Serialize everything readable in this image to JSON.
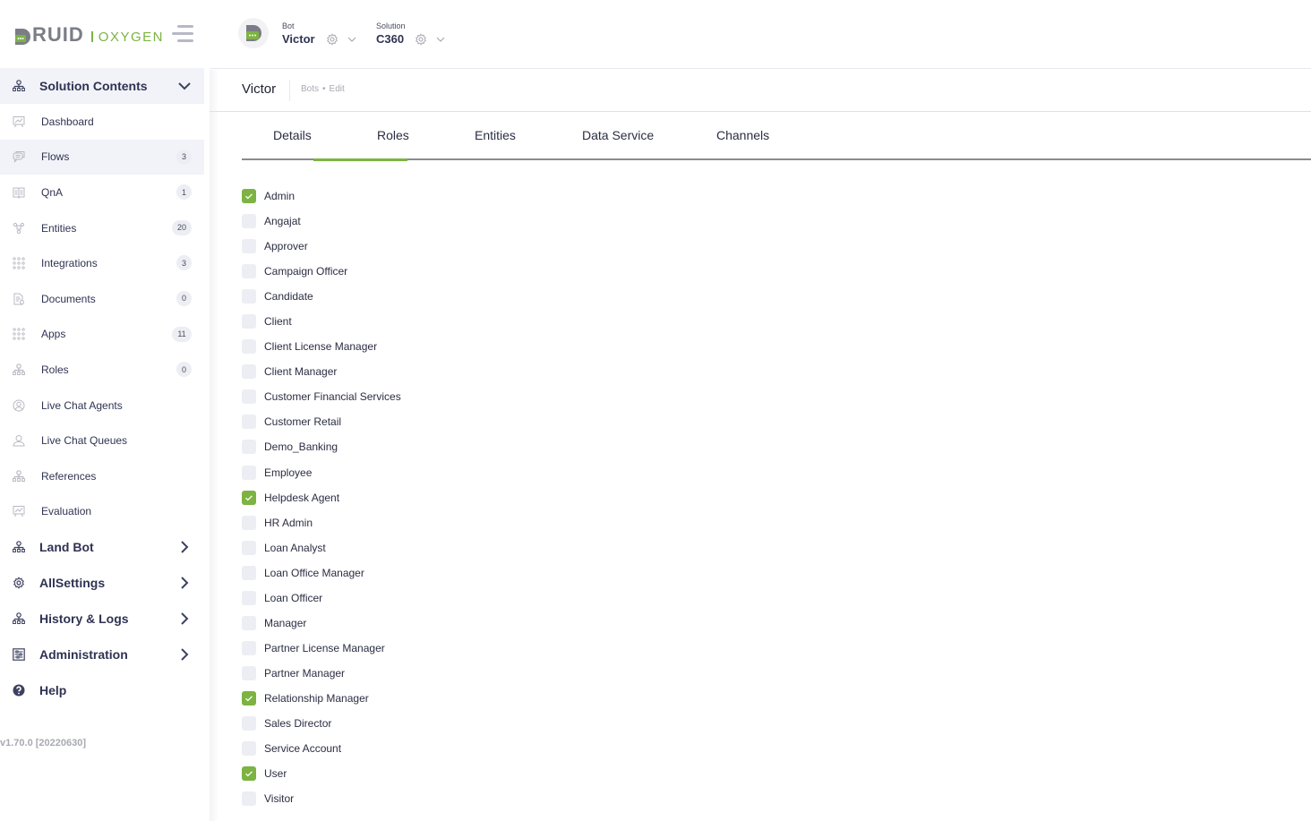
{
  "brand": {
    "name": "DRUID",
    "product": "OXYGEN",
    "accent_color": "#7cb342"
  },
  "header": {
    "bot": {
      "caption": "Bot",
      "value": "Victor"
    },
    "solution": {
      "caption": "Solution",
      "value": "C360"
    }
  },
  "sidebar": {
    "section": {
      "label": "Solution Contents",
      "icon": "sitemap-icon",
      "expanded": true
    },
    "items": [
      {
        "label": "Dashboard",
        "icon": "presentation-chart-icon",
        "badge": null,
        "active": false
      },
      {
        "label": "Flows",
        "icon": "chat-bubbles-icon",
        "badge": "3",
        "active": true
      },
      {
        "label": "QnA",
        "icon": "book-icon",
        "badge": "1",
        "active": false
      },
      {
        "label": "Entities",
        "icon": "entities-icon",
        "badge": "20",
        "active": false
      },
      {
        "label": "Integrations",
        "icon": "grid-dots-icon",
        "badge": "3",
        "active": false
      },
      {
        "label": "Documents",
        "icon": "document-icon",
        "badge": "0",
        "active": false
      },
      {
        "label": "Apps",
        "icon": "grid-dots-icon",
        "badge": "11",
        "active": false
      },
      {
        "label": "Roles",
        "icon": "sitemap-icon",
        "badge": "0",
        "active": false
      },
      {
        "label": "Live Chat Agents",
        "icon": "user-circle-icon",
        "badge": null,
        "active": false
      },
      {
        "label": "Live Chat Queues",
        "icon": "users-queue-icon",
        "badge": null,
        "active": false
      },
      {
        "label": "References",
        "icon": "sitemap-icon",
        "badge": null,
        "active": false
      },
      {
        "label": "Evaluation",
        "icon": "presentation-chart-icon",
        "badge": null,
        "active": false
      }
    ],
    "sections": [
      {
        "label": "Land Bot",
        "icon": "sitemap-icon"
      },
      {
        "label": "AllSettings",
        "icon": "gear-icon"
      },
      {
        "label": "History & Logs",
        "icon": "sitemap-icon"
      },
      {
        "label": "Administration",
        "icon": "sliders-icon"
      },
      {
        "label": "Help",
        "icon": "help-circle-icon"
      }
    ],
    "version": "v1.70.0 [20220630]"
  },
  "page": {
    "title": "Victor",
    "breadcrumb": [
      "Bots",
      "Edit"
    ],
    "tabs": [
      {
        "label": "Details",
        "active": false
      },
      {
        "label": "Roles",
        "active": true
      },
      {
        "label": "Entities",
        "active": false
      },
      {
        "label": "Data Service",
        "active": false
      },
      {
        "label": "Channels",
        "active": false
      }
    ],
    "roles": [
      {
        "label": "Admin",
        "checked": true
      },
      {
        "label": "Angajat",
        "checked": false
      },
      {
        "label": "Approver",
        "checked": false
      },
      {
        "label": "Campaign Officer",
        "checked": false
      },
      {
        "label": "Candidate",
        "checked": false
      },
      {
        "label": "Client",
        "checked": false
      },
      {
        "label": "Client License Manager",
        "checked": false
      },
      {
        "label": "Client Manager",
        "checked": false
      },
      {
        "label": "Customer Financial Services",
        "checked": false
      },
      {
        "label": "Customer Retail",
        "checked": false
      },
      {
        "label": "Demo_Banking",
        "checked": false
      },
      {
        "label": "Employee",
        "checked": false
      },
      {
        "label": "Helpdesk Agent",
        "checked": true
      },
      {
        "label": "HR Admin",
        "checked": false
      },
      {
        "label": "Loan Analyst",
        "checked": false
      },
      {
        "label": "Loan Office Manager",
        "checked": false
      },
      {
        "label": "Loan Officer",
        "checked": false
      },
      {
        "label": "Manager",
        "checked": false
      },
      {
        "label": "Partner License Manager",
        "checked": false
      },
      {
        "label": "Partner Manager",
        "checked": false
      },
      {
        "label": "Relationship Manager",
        "checked": true
      },
      {
        "label": "Sales Director",
        "checked": false
      },
      {
        "label": "Service Account",
        "checked": false
      },
      {
        "label": "User",
        "checked": true
      },
      {
        "label": "Visitor",
        "checked": false
      }
    ]
  }
}
